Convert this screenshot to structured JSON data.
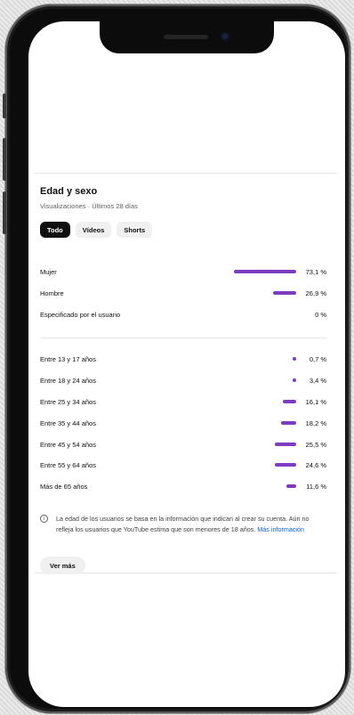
{
  "section": {
    "title": "Edad y sexo",
    "subtitle": "Visualizaciones · Últimos 28 días"
  },
  "chips": [
    {
      "label": "Todo",
      "active": true
    },
    {
      "label": "Vídeos",
      "active": false
    },
    {
      "label": "Shorts",
      "active": false
    }
  ],
  "gender": [
    {
      "label": "Mujer",
      "value": "73,1 %",
      "percent": 73.1
    },
    {
      "label": "Hombre",
      "value": "26,9 %",
      "percent": 26.9
    },
    {
      "label": "Especificado por el usuario",
      "value": "0 %",
      "percent": 0
    }
  ],
  "age": [
    {
      "label": "Entre 13 y 17 años",
      "value": "0,7 %",
      "percent": 0.7
    },
    {
      "label": "Entre 18 y 24 años",
      "value": "3,4 %",
      "percent": 3.4
    },
    {
      "label": "Entre 25 y 34 años",
      "value": "16,1 %",
      "percent": 16.1
    },
    {
      "label": "Entre 35 y 44 años",
      "value": "18,2 %",
      "percent": 18.2
    },
    {
      "label": "Entre 45 y 54 años",
      "value": "25,5 %",
      "percent": 25.5
    },
    {
      "label": "Entre 55 y 64 años",
      "value": "24,6 %",
      "percent": 24.6
    },
    {
      "label": "Más de 65 años",
      "value": "11,6 %",
      "percent": 11.6
    }
  ],
  "info": {
    "icon": "info-icon",
    "text": "La edad de los usuarios se basa en la información que indican al crear su cuenta. Aún no refleja los usuarios que YouTube estima que son menores de 18 años.",
    "link": "Más información"
  },
  "more_button": "Ver más",
  "colors": {
    "bar": "#7e3bc0",
    "link": "#065fd4",
    "chip_active": "#0f0f0f"
  }
}
